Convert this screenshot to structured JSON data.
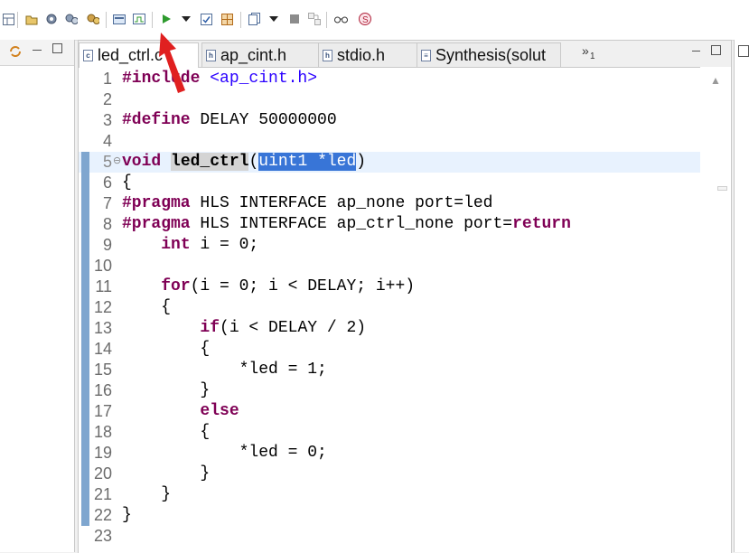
{
  "toolbar": {
    "icons": [
      "layout-icon",
      "new-solution-icon",
      "settings-gear-icon",
      "project-settings-icon",
      "c-simulation-icon",
      "open-report-icon",
      "open-wave-viewer-icon",
      "run-synthesis-icon",
      "run-dropdown-icon",
      "cosimulation-check-icon",
      "compare-reports-icon",
      "export-rtl-icon",
      "export-dropdown-icon",
      "stop-icon",
      "directive-icon",
      "view-icon",
      "debug-icon"
    ],
    "accent": "#2e9b2e"
  },
  "editor": {
    "tabs": [
      {
        "label": "led_ctrl.c",
        "icon": "c",
        "active": true
      },
      {
        "label": "ap_cint.h",
        "icon": "h",
        "active": false
      },
      {
        "label": "stdio.h",
        "icon": "h",
        "active": false
      },
      {
        "label": "Synthesis(solut",
        "icon": "report",
        "active": false
      }
    ],
    "overflow_label": "»",
    "overflow_count": "1",
    "lines": [
      {
        "n": "1",
        "parts": [
          {
            "t": "#include ",
            "c": "kw"
          },
          {
            "t": "<ap_cint.h>",
            "c": "str"
          }
        ]
      },
      {
        "n": "2",
        "parts": []
      },
      {
        "n": "3",
        "parts": [
          {
            "t": "#define",
            "c": "kw"
          },
          {
            "t": " DELAY 50000000",
            "c": ""
          }
        ]
      },
      {
        "n": "4",
        "parts": []
      },
      {
        "n": "5",
        "parts": [
          {
            "t": "void",
            "c": "kw"
          },
          {
            "t": " ",
            "c": ""
          },
          {
            "t": "led_ctrl",
            "c": "fn"
          },
          {
            "t": "(",
            "c": ""
          },
          {
            "t": "uint1 *led",
            "c": "sel"
          },
          {
            "t": ")",
            "c": ""
          }
        ]
      },
      {
        "n": "6",
        "parts": [
          {
            "t": "{",
            "c": ""
          }
        ]
      },
      {
        "n": "7",
        "parts": [
          {
            "t": "#pragma",
            "c": "kw"
          },
          {
            "t": " HLS INTERFACE ap_none port=led",
            "c": ""
          }
        ]
      },
      {
        "n": "8",
        "parts": [
          {
            "t": "#pragma",
            "c": "kw"
          },
          {
            "t": " HLS INTERFACE ap_ctrl_none port=",
            "c": ""
          },
          {
            "t": "return",
            "c": "kw"
          }
        ]
      },
      {
        "n": "9",
        "parts": [
          {
            "t": "    ",
            "c": ""
          },
          {
            "t": "int",
            "c": "kw"
          },
          {
            "t": " i = 0;",
            "c": ""
          }
        ]
      },
      {
        "n": "10",
        "parts": []
      },
      {
        "n": "11",
        "parts": [
          {
            "t": "    ",
            "c": ""
          },
          {
            "t": "for",
            "c": "kw"
          },
          {
            "t": "(i = 0; i < DELAY; i++)",
            "c": ""
          }
        ]
      },
      {
        "n": "12",
        "parts": [
          {
            "t": "    {",
            "c": ""
          }
        ]
      },
      {
        "n": "13",
        "parts": [
          {
            "t": "        ",
            "c": ""
          },
          {
            "t": "if",
            "c": "kw"
          },
          {
            "t": "(i < DELAY / 2)",
            "c": ""
          }
        ]
      },
      {
        "n": "14",
        "parts": [
          {
            "t": "        {",
            "c": ""
          }
        ]
      },
      {
        "n": "15",
        "parts": [
          {
            "t": "            *led = 1;",
            "c": ""
          }
        ]
      },
      {
        "n": "16",
        "parts": [
          {
            "t": "        }",
            "c": ""
          }
        ]
      },
      {
        "n": "17",
        "parts": [
          {
            "t": "        ",
            "c": ""
          },
          {
            "t": "else",
            "c": "kw"
          }
        ]
      },
      {
        "n": "18",
        "parts": [
          {
            "t": "        {",
            "c": ""
          }
        ]
      },
      {
        "n": "19",
        "parts": [
          {
            "t": "            *led = 0;",
            "c": ""
          }
        ]
      },
      {
        "n": "20",
        "parts": [
          {
            "t": "        }",
            "c": ""
          }
        ]
      },
      {
        "n": "21",
        "parts": [
          {
            "t": "    }",
            "c": ""
          }
        ]
      },
      {
        "n": "22",
        "parts": [
          {
            "t": "}",
            "c": ""
          }
        ]
      },
      {
        "n": "23",
        "parts": []
      }
    ]
  },
  "colors": {
    "keyword": "#7f0055",
    "string": "#2a00ff",
    "selection": "#3875d7",
    "current_line": "#e8f2fe",
    "annotation_arrow": "#e02020"
  }
}
